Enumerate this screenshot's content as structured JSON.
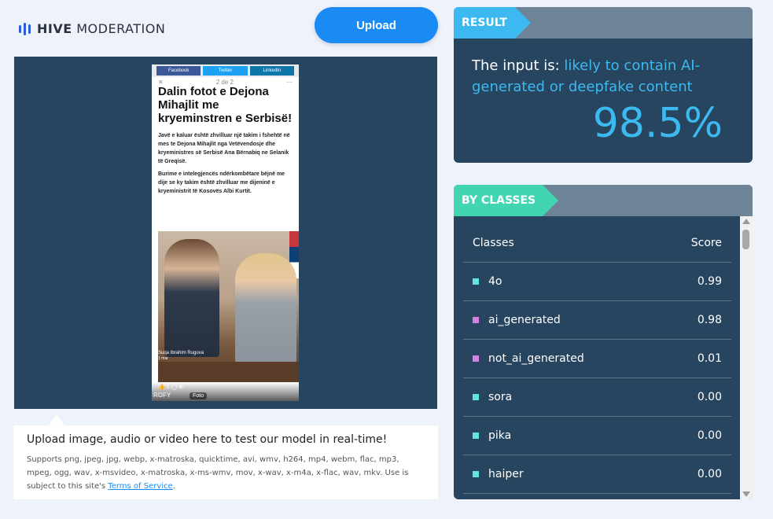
{
  "brand": {
    "bold": "HIVE",
    "rest": " MODERATION"
  },
  "upload_label": "Upload",
  "preview": {
    "share": [
      "Facebook",
      "Twitter",
      "LinkedIn"
    ],
    "counter": "2 de 2",
    "title": "Dalin fotot e Dejona Mihajlit me kryeminstren e Serbisë!",
    "para1": "Javë e kaluar është zhvilluar një takim i fshehtë në mes te Dejona Mihajlit nga Vetëvendosje dhe kryeministres së Serbisë Ana Bërnabiq ne Selanik të Greqisë.",
    "para2": "Burime e intelegjencës ndërkombëtare bëjnë me dije se ky takim është zhvilluar me dijeninë e kryeministrit të Kosovës Albi Kurtit.",
    "caption": "Suqa Ibrahim Rugova",
    "date": "1 mar",
    "reactions": "👍 1   ◯   ⊕",
    "watermark": "ROFY",
    "foto_label": "Foto"
  },
  "info": {
    "heading": "Upload image, audio or video here to test our model in real-time!",
    "supports": "Supports png, jpeg, jpg, webp, x-matroska, quicktime, avi, wmv, h264, mp4, webm, flac, mp3, mpeg, ogg, wav, x-msvideo, x-matroska, x-ms-wmv, mov, x-wav, x-m4a, x-flac, wav, mkv. Use is subject to this site's ",
    "tos": "Terms of Service",
    "end": "."
  },
  "result": {
    "tag": "RESULT",
    "prefix": "The input is: ",
    "verdict": "likely to contain AI-generated or deepfake content",
    "percent": "98.5%"
  },
  "classes": {
    "tag": "BY CLASSES",
    "col_class": "Classes",
    "col_score": "Score",
    "rows": [
      {
        "name": "4o",
        "score": "0.99",
        "color": "#5fe6e0"
      },
      {
        "name": "ai_generated",
        "score": "0.98",
        "color": "#d77ee6"
      },
      {
        "name": "not_ai_generated",
        "score": "0.01",
        "color": "#d77ee6"
      },
      {
        "name": "sora",
        "score": "0.00",
        "color": "#5fe6e0"
      },
      {
        "name": "pika",
        "score": "0.00",
        "color": "#5fe6e0"
      },
      {
        "name": "haiper",
        "score": "0.00",
        "color": "#5fe6e0"
      }
    ]
  },
  "colors": {
    "accent": "#1a8bf5",
    "result_tag": "#3cb9f0",
    "classes_tag": "#41d6b1",
    "panel": "#27455f"
  }
}
